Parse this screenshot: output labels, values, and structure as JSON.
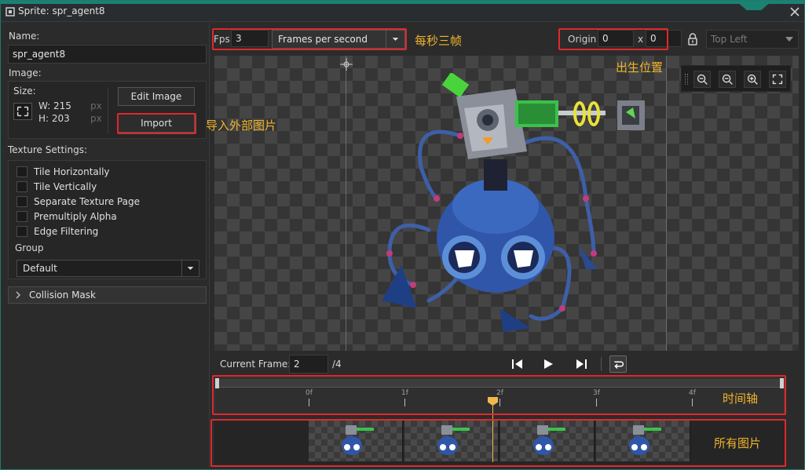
{
  "window": {
    "title": "Sprite: spr_agent8"
  },
  "left": {
    "name_label": "Name:",
    "name_value": "spr_agent8",
    "image_label": "Image:",
    "size_label": "Size:",
    "width_text": "W: 215",
    "height_text": "H: 203",
    "px_unit": "px",
    "edit_image_label": "Edit Image",
    "import_label": "Import",
    "texture_settings_label": "Texture Settings:",
    "checkboxes": [
      {
        "label": "Tile Horizontally",
        "checked": false
      },
      {
        "label": "Tile Vertically",
        "checked": false
      },
      {
        "label": "Separate Texture Page",
        "checked": false
      },
      {
        "label": "Premultiply Alpha",
        "checked": false
      },
      {
        "label": "Edge Filtering",
        "checked": false
      }
    ],
    "group_label": "Group",
    "group_value": "Default",
    "collision_mask_label": "Collision Mask"
  },
  "toolbar": {
    "fps_label": "Fps",
    "fps_value": "3",
    "fps_mode": "Frames per second",
    "origin_label": "Origin",
    "origin_x": "0",
    "origin_sep": "x",
    "origin_y": "0",
    "anchor": "Top Left"
  },
  "playback": {
    "current_frame_label": "Current Frame:",
    "current_frame_value": "2",
    "total_frames": "/4"
  },
  "timeline": {
    "ticks": [
      "0f",
      "1f",
      "2f",
      "3f",
      "4f"
    ]
  },
  "annotations": {
    "fps": "每秒三帧",
    "import": "导入外部图片",
    "origin": "出生位置",
    "timeline": "时间轴",
    "frames": "所有图片"
  },
  "colors": {
    "accent": "#1b8272",
    "highlight": "#e0282c",
    "annotation": "#f1b52c",
    "playhead": "#f0b94a"
  }
}
